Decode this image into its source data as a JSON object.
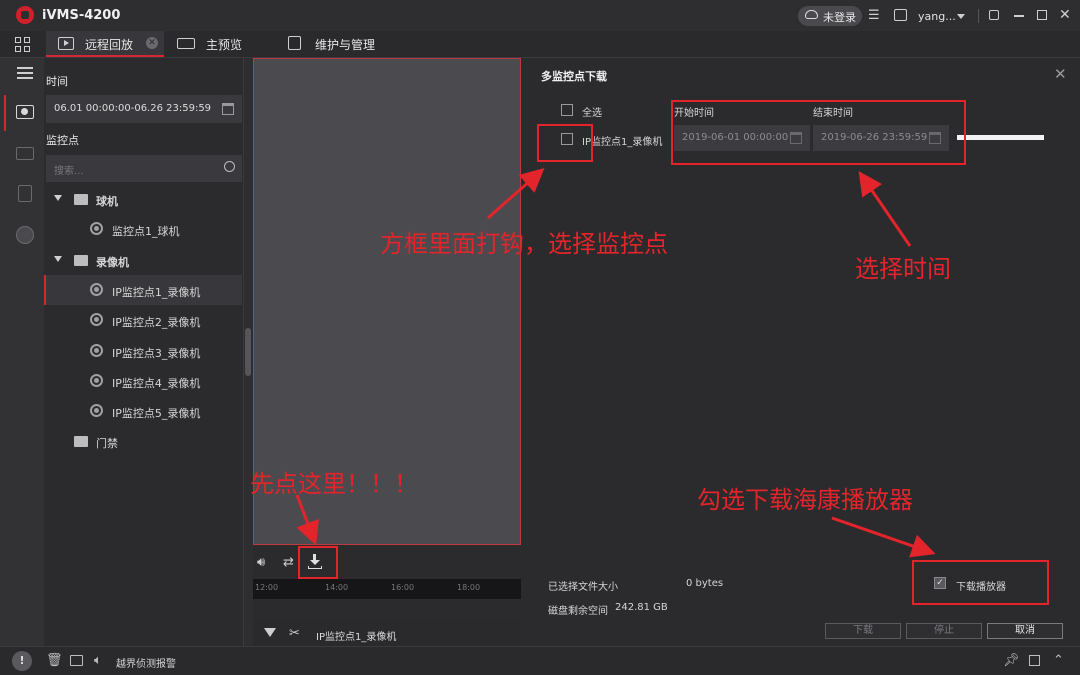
{
  "app": {
    "title": "iVMS-4200",
    "login_label": "未登录",
    "user": "yang..."
  },
  "tabs": [
    {
      "label": "远程回放"
    },
    {
      "label": "主预览"
    },
    {
      "label": "维护与管理"
    }
  ],
  "left_panel": {
    "time_label": "时间",
    "time_range": "06.01 00:00:00-06.26 23:59:59",
    "points_label": "监控点",
    "search_placeholder": "搜索...",
    "tree": [
      {
        "label": "球机"
      },
      {
        "label": "监控点1_球机"
      },
      {
        "label": "录像机"
      },
      {
        "label": "IP监控点1_录像机"
      },
      {
        "label": "IP监控点2_录像机"
      },
      {
        "label": "IP监控点3_录像机"
      },
      {
        "label": "IP监控点4_录像机"
      },
      {
        "label": "IP监控点5_录像机"
      },
      {
        "label": "门禁"
      }
    ]
  },
  "timeline": {
    "ticks": [
      "12:00",
      "14:00",
      "16:00",
      "18:00"
    ]
  },
  "bottom_strip": {
    "label": "IP监控点1_录像机"
  },
  "dialog": {
    "title": "多监控点下载",
    "select_all": "全选",
    "start_time_label": "开始时间",
    "end_time_label": "结束时间",
    "row_label": "IP监控点1_录像机",
    "start_time": "2019-06-01 00:00:00",
    "end_time": "2019-06-26 23:59:59",
    "progress": 1.0,
    "selected_size_label": "已选择文件大小",
    "selected_size": "0 bytes",
    "disk_space_label": "磁盘剩余空间",
    "disk_space": "242.81 GB",
    "download_player_label": "下载播放器",
    "download_player_checked": true,
    "buttons": {
      "download": "下载",
      "stop": "停止",
      "cancel": "取消"
    }
  },
  "annotations": {
    "first_click": "先点这里！！！",
    "check_box": "方框里面打钩，选择监控点",
    "select_time": "选择时间",
    "check_player": "勾选下载海康播放器"
  },
  "status_bar": {
    "alarm_text": "越界侦测报警"
  },
  "colors": {
    "accent": "#d6262f",
    "annotation": "#e3242b"
  }
}
